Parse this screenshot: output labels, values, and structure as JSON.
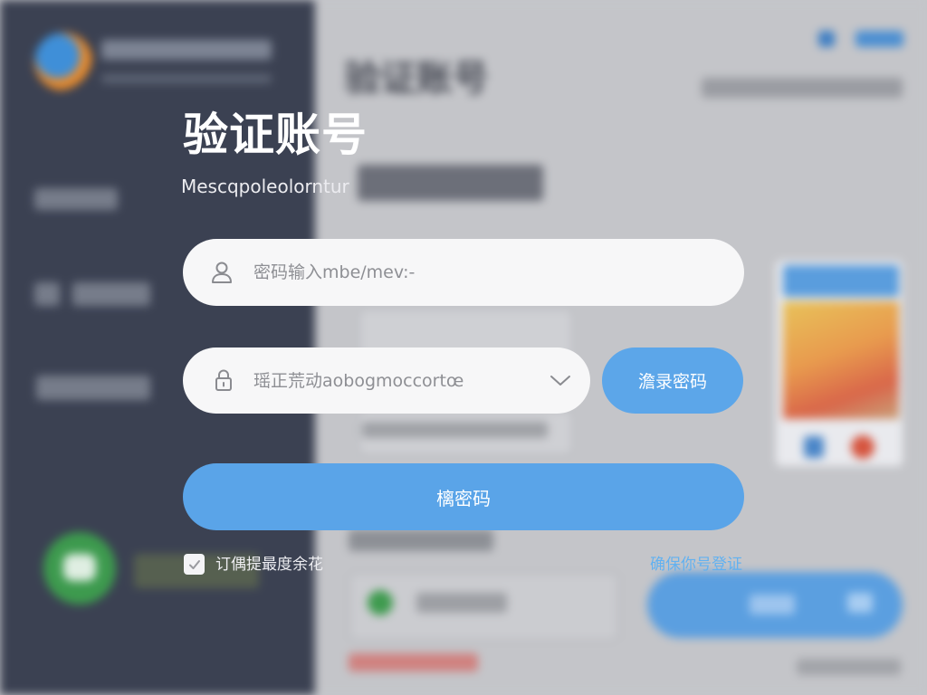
{
  "background": {
    "title": "验证账号"
  },
  "dialog": {
    "title": "验证账号",
    "subtitle": "Mescqpoleolorntur",
    "account_input": {
      "placeholder": "密码输入mbe/mev:-",
      "icon": "user-icon"
    },
    "code_input": {
      "placeholder": "瑶正荒动aobogmoccortœ",
      "icon": "lock-icon",
      "dropdown_icon": "chevron-down-icon"
    },
    "send_code_button": "澹录密码",
    "submit_button": "樆密码",
    "remember_checkbox": {
      "label": "订偶提最度余花",
      "checked": true
    },
    "help_link": "确保你号登证"
  },
  "colors": {
    "accent": "#5aa4e8",
    "link": "#62b1f0",
    "sidebar": "#3b4152",
    "background": "#c4c5c9",
    "input_background": "#f7f7f8"
  }
}
